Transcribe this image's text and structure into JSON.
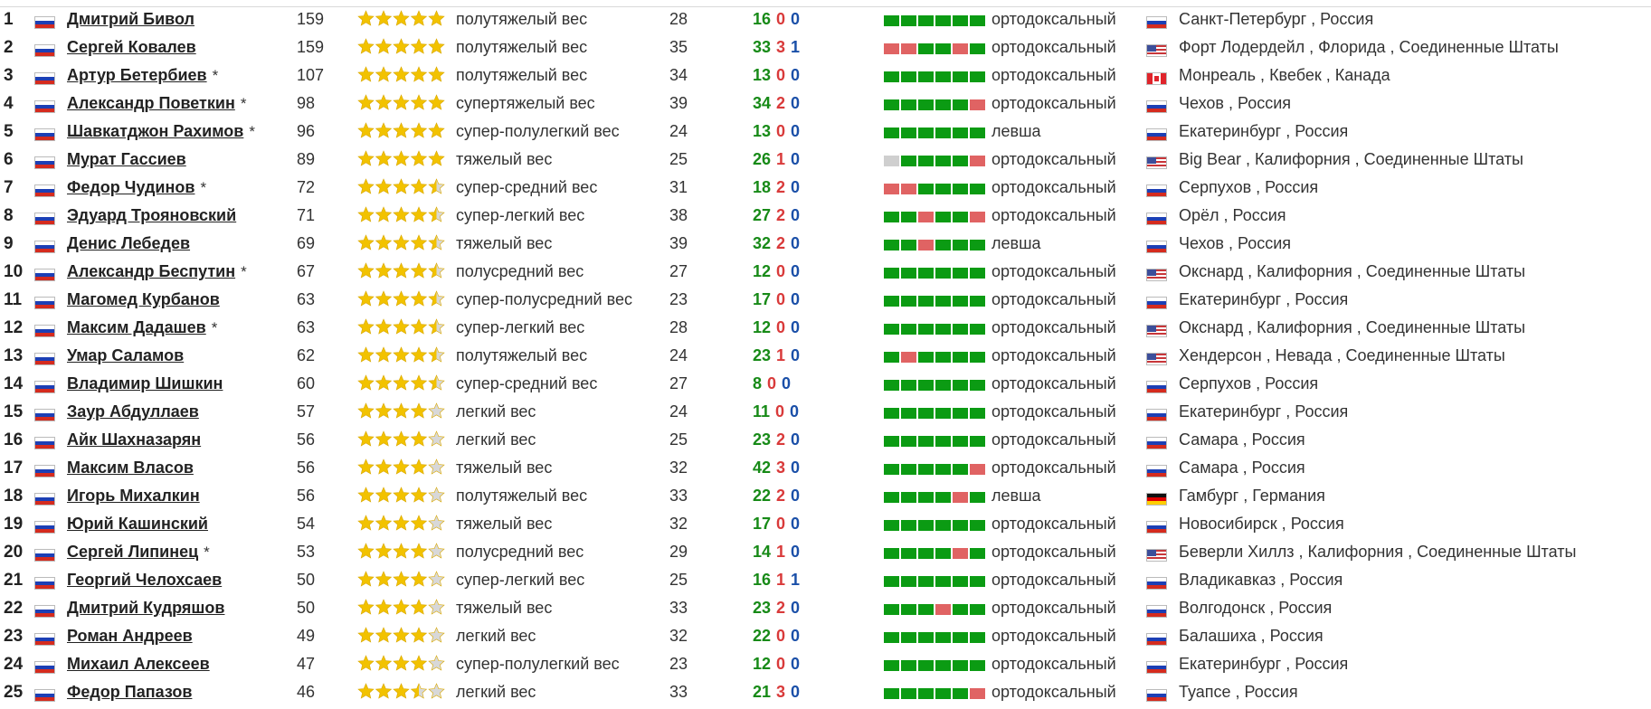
{
  "boxers": [
    {
      "rank": "1",
      "flag": "ru",
      "name": "Дмитрий Бивол",
      "marker": "",
      "points": "159",
      "stars": 5,
      "division": "полутяжелый вес",
      "age": "28",
      "wins": "16",
      "losses": "0",
      "draws": "0",
      "form": [
        "W",
        "W",
        "W",
        "W",
        "W",
        "W"
      ],
      "stance": "ортодоксальный",
      "country_flag": "ru",
      "location": "Санкт-Петербург , Россия"
    },
    {
      "rank": "2",
      "flag": "ru",
      "name": "Сергей Ковалев",
      "marker": "",
      "points": "159",
      "stars": 5,
      "division": "полутяжелый вес",
      "age": "35",
      "wins": "33",
      "losses": "3",
      "draws": "1",
      "form": [
        "L",
        "L",
        "W",
        "W",
        "L",
        "W"
      ],
      "stance": "ортодоксальный",
      "country_flag": "us",
      "location": "Форт Лодердейл , Флорида , Соединенные Штаты"
    },
    {
      "rank": "3",
      "flag": "ru",
      "name": "Артур Бетербиев",
      "marker": "*",
      "points": "107",
      "stars": 5,
      "division": "полутяжелый вес",
      "age": "34",
      "wins": "13",
      "losses": "0",
      "draws": "0",
      "form": [
        "W",
        "W",
        "W",
        "W",
        "W",
        "W"
      ],
      "stance": "ортодоксальный",
      "country_flag": "ca",
      "location": "Монреаль , Квебек , Канада"
    },
    {
      "rank": "4",
      "flag": "ru",
      "name": "Александр Поветкин",
      "marker": "*",
      "points": "98",
      "stars": 5,
      "division": "супертяжелый вес",
      "age": "39",
      "wins": "34",
      "losses": "2",
      "draws": "0",
      "form": [
        "W",
        "W",
        "W",
        "W",
        "W",
        "L"
      ],
      "stance": "ортодоксальный",
      "country_flag": "ru",
      "location": "Чехов , Россия"
    },
    {
      "rank": "5",
      "flag": "ru",
      "name": "Шавкатджон Рахимов",
      "marker": "*",
      "points": "96",
      "stars": 5,
      "division": "супер-полулегкий вес",
      "age": "24",
      "wins": "13",
      "losses": "0",
      "draws": "0",
      "form": [
        "W",
        "W",
        "W",
        "W",
        "W",
        "W"
      ],
      "stance": "левша",
      "country_flag": "ru",
      "location": "Екатеринбург , Россия"
    },
    {
      "rank": "6",
      "flag": "ru",
      "name": "Мурат Гассиев",
      "marker": "",
      "points": "89",
      "stars": 5,
      "division": "тяжелый вес",
      "age": "25",
      "wins": "26",
      "losses": "1",
      "draws": "0",
      "form": [
        "N",
        "W",
        "W",
        "W",
        "W",
        "L"
      ],
      "stance": "ортодоксальный",
      "country_flag": "us",
      "location": "Big Bear , Калифорния , Соединенные Штаты"
    },
    {
      "rank": "7",
      "flag": "ru",
      "name": "Федор Чудинов",
      "marker": "*",
      "points": "72",
      "stars": 4.5,
      "division": "супер-средний вес",
      "age": "31",
      "wins": "18",
      "losses": "2",
      "draws": "0",
      "form": [
        "L",
        "L",
        "W",
        "W",
        "W",
        "W"
      ],
      "stance": "ортодоксальный",
      "country_flag": "ru",
      "location": "Серпухов , Россия"
    },
    {
      "rank": "8",
      "flag": "ru",
      "name": "Эдуард Трояновский",
      "marker": "",
      "points": "71",
      "stars": 4.5,
      "division": "супер-легкий вес",
      "age": "38",
      "wins": "27",
      "losses": "2",
      "draws": "0",
      "form": [
        "W",
        "W",
        "L",
        "W",
        "W",
        "L"
      ],
      "stance": "ортодоксальный",
      "country_flag": "ru",
      "location": "Орёл , Россия"
    },
    {
      "rank": "9",
      "flag": "ru",
      "name": "Денис Лебедев",
      "marker": "",
      "points": "69",
      "stars": 4.5,
      "division": "тяжелый вес",
      "age": "39",
      "wins": "32",
      "losses": "2",
      "draws": "0",
      "form": [
        "W",
        "W",
        "L",
        "W",
        "W",
        "W"
      ],
      "stance": "левша",
      "country_flag": "ru",
      "location": "Чехов , Россия"
    },
    {
      "rank": "10",
      "flag": "ru",
      "name": "Александр Беспутин",
      "marker": "*",
      "points": "67",
      "stars": 4.5,
      "division": "полусредний вес",
      "age": "27",
      "wins": "12",
      "losses": "0",
      "draws": "0",
      "form": [
        "W",
        "W",
        "W",
        "W",
        "W",
        "W"
      ],
      "stance": "ортодоксальный",
      "country_flag": "us",
      "location": "Окснард , Калифорния , Соединенные Штаты"
    },
    {
      "rank": "11",
      "flag": "ru",
      "name": "Магомед Курбанов",
      "marker": "",
      "points": "63",
      "stars": 4.5,
      "division": "супер-полусредний вес",
      "age": "23",
      "wins": "17",
      "losses": "0",
      "draws": "0",
      "form": [
        "W",
        "W",
        "W",
        "W",
        "W",
        "W"
      ],
      "stance": "ортодоксальный",
      "country_flag": "ru",
      "location": "Екатеринбург , Россия"
    },
    {
      "rank": "12",
      "flag": "ru",
      "name": "Максим Дадашев",
      "marker": "*",
      "points": "63",
      "stars": 4.5,
      "division": "супер-легкий вес",
      "age": "28",
      "wins": "12",
      "losses": "0",
      "draws": "0",
      "form": [
        "W",
        "W",
        "W",
        "W",
        "W",
        "W"
      ],
      "stance": "ортодоксальный",
      "country_flag": "us",
      "location": "Окснард , Калифорния , Соединенные Штаты"
    },
    {
      "rank": "13",
      "flag": "ru",
      "name": "Умар Саламов",
      "marker": "",
      "points": "62",
      "stars": 4.5,
      "division": "полутяжелый вес",
      "age": "24",
      "wins": "23",
      "losses": "1",
      "draws": "0",
      "form": [
        "W",
        "L",
        "W",
        "W",
        "W",
        "W"
      ],
      "stance": "ортодоксальный",
      "country_flag": "us",
      "location": "Хендерсон , Невада , Соединенные Штаты"
    },
    {
      "rank": "14",
      "flag": "ru",
      "name": "Владимир Шишкин",
      "marker": "",
      "points": "60",
      "stars": 4.5,
      "division": "супер-средний вес",
      "age": "27",
      "wins": "8",
      "losses": "0",
      "draws": "0",
      "form": [
        "W",
        "W",
        "W",
        "W",
        "W",
        "W"
      ],
      "stance": "ортодоксальный",
      "country_flag": "ru",
      "location": "Серпухов , Россия"
    },
    {
      "rank": "15",
      "flag": "ru",
      "name": "Заур Абдуллаев",
      "marker": "",
      "points": "57",
      "stars": 4,
      "division": "легкий вес",
      "age": "24",
      "wins": "11",
      "losses": "0",
      "draws": "0",
      "form": [
        "W",
        "W",
        "W",
        "W",
        "W",
        "W"
      ],
      "stance": "ортодоксальный",
      "country_flag": "ru",
      "location": "Екатеринбург , Россия"
    },
    {
      "rank": "16",
      "flag": "ru",
      "name": "Айк Шахназарян",
      "marker": "",
      "points": "56",
      "stars": 4,
      "division": "легкий вес",
      "age": "25",
      "wins": "23",
      "losses": "2",
      "draws": "0",
      "form": [
        "W",
        "W",
        "W",
        "W",
        "W",
        "W"
      ],
      "stance": "ортодоксальный",
      "country_flag": "ru",
      "location": "Самара , Россия"
    },
    {
      "rank": "17",
      "flag": "ru",
      "name": "Максим Власов",
      "marker": "",
      "points": "56",
      "stars": 4,
      "division": "тяжелый вес",
      "age": "32",
      "wins": "42",
      "losses": "3",
      "draws": "0",
      "form": [
        "W",
        "W",
        "W",
        "W",
        "W",
        "L"
      ],
      "stance": "ортодоксальный",
      "country_flag": "ru",
      "location": "Самара , Россия"
    },
    {
      "rank": "18",
      "flag": "ru",
      "name": "Игорь Михалкин",
      "marker": "",
      "points": "56",
      "stars": 4,
      "division": "полутяжелый вес",
      "age": "33",
      "wins": "22",
      "losses": "2",
      "draws": "0",
      "form": [
        "W",
        "W",
        "W",
        "W",
        "L",
        "W"
      ],
      "stance": "левша",
      "country_flag": "de",
      "location": "Гамбург , Германия"
    },
    {
      "rank": "19",
      "flag": "ru",
      "name": "Юрий Кашинский",
      "marker": "",
      "points": "54",
      "stars": 4,
      "division": "тяжелый вес",
      "age": "32",
      "wins": "17",
      "losses": "0",
      "draws": "0",
      "form": [
        "W",
        "W",
        "W",
        "W",
        "W",
        "W"
      ],
      "stance": "ортодоксальный",
      "country_flag": "ru",
      "location": "Новосибирск , Россия"
    },
    {
      "rank": "20",
      "flag": "ru",
      "name": "Сергей Липинец",
      "marker": "*",
      "points": "53",
      "stars": 4,
      "division": "полусредний вес",
      "age": "29",
      "wins": "14",
      "losses": "1",
      "draws": "0",
      "form": [
        "W",
        "W",
        "W",
        "W",
        "L",
        "W"
      ],
      "stance": "ортодоксальный",
      "country_flag": "us",
      "location": "Беверли Хиллз , Калифорния , Соединенные Штаты"
    },
    {
      "rank": "21",
      "flag": "ru",
      "name": "Георгий Челохсаев",
      "marker": "",
      "points": "50",
      "stars": 4,
      "division": "супер-легкий вес",
      "age": "25",
      "wins": "16",
      "losses": "1",
      "draws": "1",
      "form": [
        "W",
        "W",
        "W",
        "W",
        "W",
        "W"
      ],
      "stance": "ортодоксальный",
      "country_flag": "ru",
      "location": "Владикавказ , Россия"
    },
    {
      "rank": "22",
      "flag": "ru",
      "name": "Дмитрий Кудряшов",
      "marker": "",
      "points": "50",
      "stars": 4,
      "division": "тяжелый вес",
      "age": "33",
      "wins": "23",
      "losses": "2",
      "draws": "0",
      "form": [
        "W",
        "W",
        "W",
        "L",
        "W",
        "W"
      ],
      "stance": "ортодоксальный",
      "country_flag": "ru",
      "location": "Волгодонск , Россия"
    },
    {
      "rank": "23",
      "flag": "ru",
      "name": "Роман Андреев",
      "marker": "",
      "points": "49",
      "stars": 4,
      "division": "легкий вес",
      "age": "32",
      "wins": "22",
      "losses": "0",
      "draws": "0",
      "form": [
        "W",
        "W",
        "W",
        "W",
        "W",
        "W"
      ],
      "stance": "ортодоксальный",
      "country_flag": "ru",
      "location": "Балашиха , Россия"
    },
    {
      "rank": "24",
      "flag": "ru",
      "name": "Михаил Алексеев",
      "marker": "",
      "points": "47",
      "stars": 4,
      "division": "супер-полулегкий вес",
      "age": "23",
      "wins": "12",
      "losses": "0",
      "draws": "0",
      "form": [
        "W",
        "W",
        "W",
        "W",
        "W",
        "W"
      ],
      "stance": "ортодоксальный",
      "country_flag": "ru",
      "location": "Екатеринбург , Россия"
    },
    {
      "rank": "25",
      "flag": "ru",
      "name": "Федор Папазов",
      "marker": "",
      "points": "46",
      "stars": 3.5,
      "division": "легкий вес",
      "age": "33",
      "wins": "21",
      "losses": "3",
      "draws": "0",
      "form": [
        "W",
        "W",
        "W",
        "W",
        "W",
        "L"
      ],
      "stance": "ортодоксальный",
      "country_flag": "ru",
      "location": "Туапсе , Россия"
    }
  ],
  "colors": {
    "win": "#178a17",
    "loss": "#d93a3a",
    "draw": "#1a4fa8",
    "form_win": "#0b9b13",
    "form_loss": "#e06363",
    "form_none": "#cfcfcf",
    "star": "#f2c200",
    "star_empty": "#d8d8d8"
  }
}
